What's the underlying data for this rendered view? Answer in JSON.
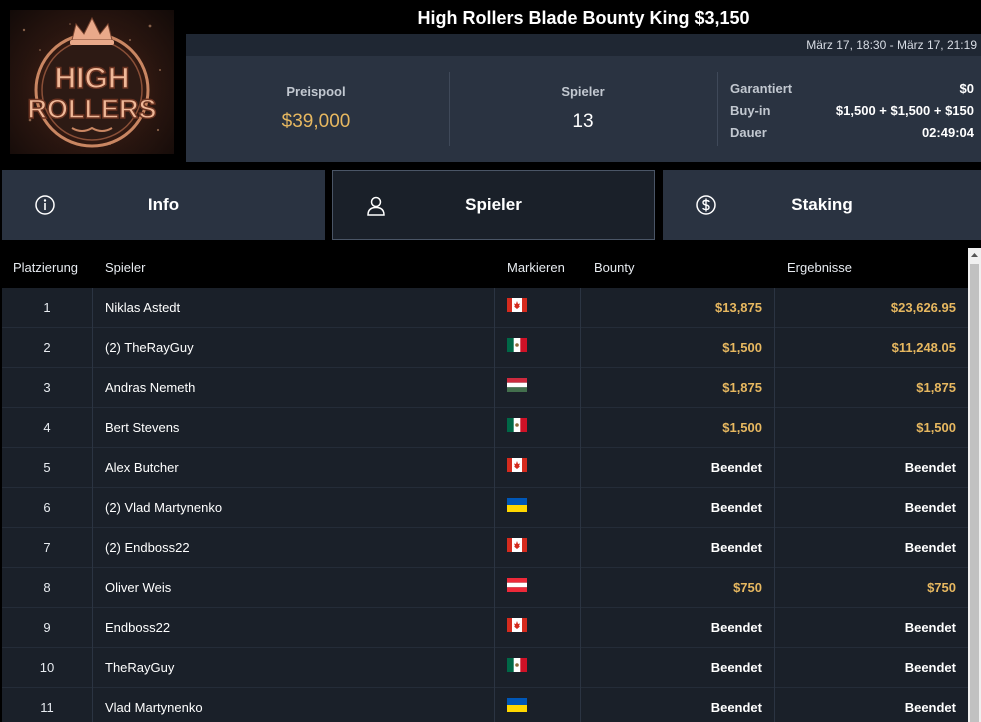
{
  "header": {
    "title": "High Rollers Blade Bounty King $3,150",
    "date_range": "März 17, 18:30 - März 17, 21:19",
    "logo_text_1": "HIGH",
    "logo_text_2": "ROLLERS"
  },
  "stats": {
    "prizepool_label": "Preispool",
    "prizepool_value": "$39,000",
    "players_label": "Spieler",
    "players_value": "13",
    "guaranteed_label": "Garantiert",
    "guaranteed_value": "$0",
    "buyin_label": "Buy-in",
    "buyin_value": "$1,500 + $1,500 + $150",
    "duration_label": "Dauer",
    "duration_value": "02:49:04"
  },
  "tabs": [
    {
      "label": "Info",
      "icon": "info-icon"
    },
    {
      "label": "Spieler",
      "icon": "user-icon"
    },
    {
      "label": "Staking",
      "icon": "dollar-coin-icon"
    }
  ],
  "table": {
    "headers": {
      "place": "Platzierung",
      "player": "Spieler",
      "flag": "Markieren",
      "bounty": "Bounty",
      "result": "Ergebnisse"
    },
    "rows": [
      {
        "place": "1",
        "name": "Niklas Astedt",
        "flag": "CA",
        "bounty": "$13,875",
        "result": "$23,626.95"
      },
      {
        "place": "2",
        "name": "(2) TheRayGuy",
        "flag": "MX",
        "bounty": "$1,500",
        "result": "$11,248.05"
      },
      {
        "place": "3",
        "name": "Andras Nemeth",
        "flag": "HU",
        "bounty": "$1,875",
        "result": "$1,875"
      },
      {
        "place": "4",
        "name": "Bert Stevens",
        "flag": "MX",
        "bounty": "$1,500",
        "result": "$1,500"
      },
      {
        "place": "5",
        "name": "Alex Butcher",
        "flag": "CA",
        "bounty": "Beendet",
        "result": "Beendet"
      },
      {
        "place": "6",
        "name": "(2) Vlad Martynenko",
        "flag": "UA",
        "bounty": "Beendet",
        "result": "Beendet"
      },
      {
        "place": "7",
        "name": "(2) Endboss22",
        "flag": "CA",
        "bounty": "Beendet",
        "result": "Beendet"
      },
      {
        "place": "8",
        "name": "Oliver Weis",
        "flag": "AT",
        "bounty": "$750",
        "result": "$750"
      },
      {
        "place": "9",
        "name": "Endboss22",
        "flag": "CA",
        "bounty": "Beendet",
        "result": "Beendet"
      },
      {
        "place": "10",
        "name": "TheRayGuy",
        "flag": "MX",
        "bounty": "Beendet",
        "result": "Beendet"
      },
      {
        "place": "11",
        "name": "Vlad Martynenko",
        "flag": "UA",
        "bounty": "Beendet",
        "result": "Beendet"
      }
    ]
  },
  "colors": {
    "gold": "#e7b860",
    "panel": "#2a3341",
    "table_bg": "#1a2029"
  }
}
